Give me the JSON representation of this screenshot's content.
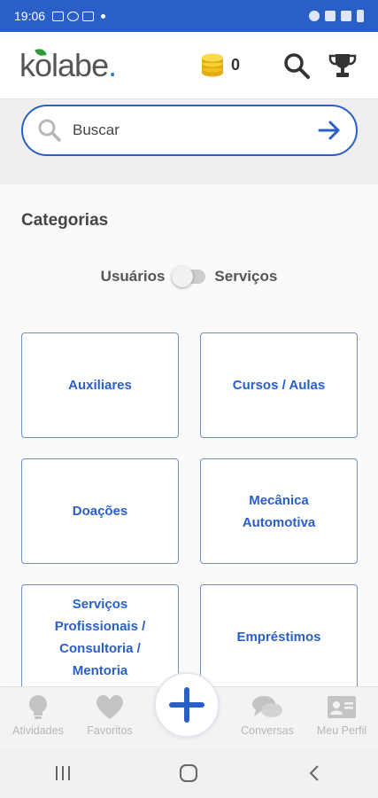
{
  "status_bar": {
    "time": "19:06"
  },
  "header": {
    "logo_text": "kolabe",
    "logo_dot": ".",
    "coins_count": "0"
  },
  "search": {
    "placeholder": "Buscar"
  },
  "main": {
    "section_title": "Categorias",
    "toggle_left": "Usuários",
    "toggle_right": "Serviços",
    "categories": [
      "Auxiliares",
      "Cursos / Aulas",
      "Doações",
      "Mecânica\nAutomotiva",
      "Serviços\nProfissionais /\nConsultoria /\nMentoria",
      "Empréstimos"
    ]
  },
  "bottom_nav": {
    "atividades": "Atividades",
    "favoritos": "Favoritos",
    "conversas": "Conversas",
    "meu_perfil": "Meu Perfil"
  },
  "colors": {
    "primary": "#2a5fc8",
    "coin": "#f2c01b",
    "leaf": "#2e9b3a",
    "inactive": "#b7b7b7"
  },
  "icons": [
    "search-icon",
    "trophy-icon",
    "coins-icon",
    "arrow-right-icon",
    "lightbulb-icon",
    "heart-icon",
    "plus-icon",
    "chat-icon",
    "profile-card-icon"
  ]
}
